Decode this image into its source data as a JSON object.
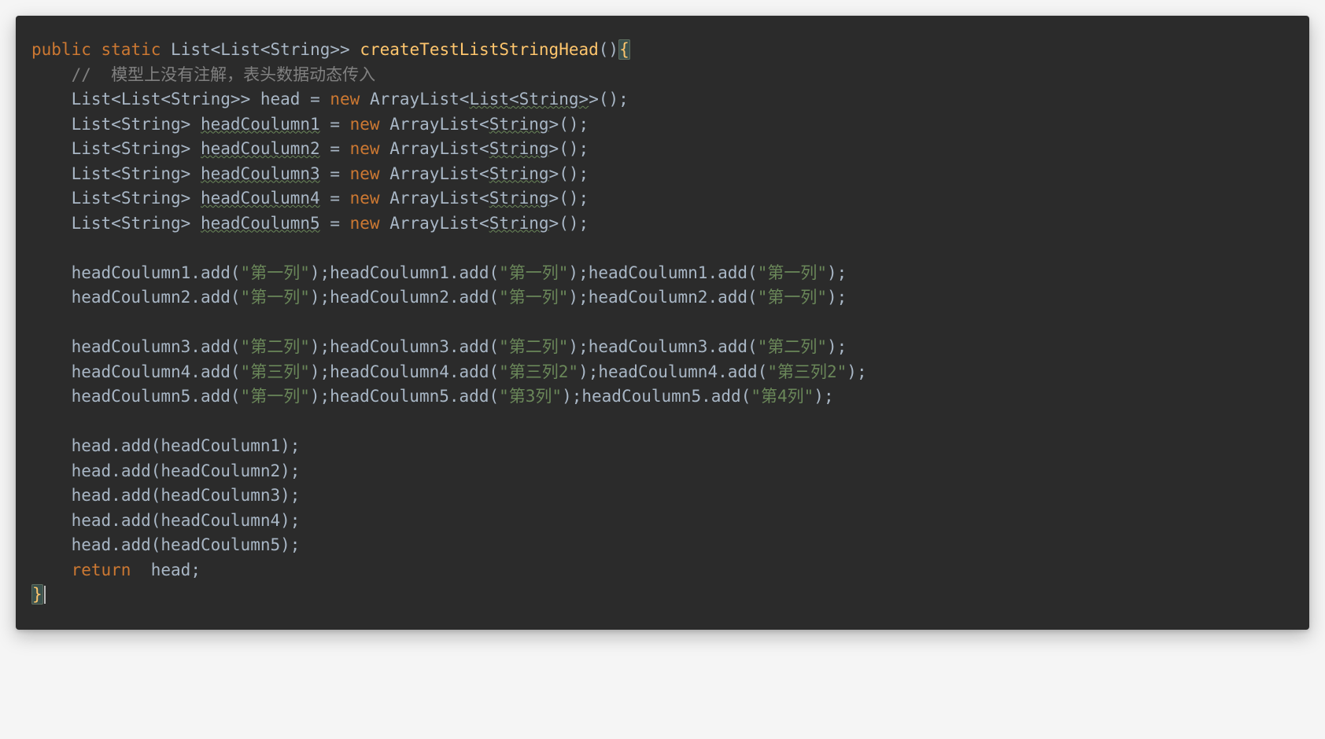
{
  "code": {
    "keywords": {
      "public": "public",
      "static": "static",
      "new": "new",
      "return": "return"
    },
    "types": {
      "List": "List",
      "String": "String",
      "ArrayList": "ArrayList"
    },
    "methodName": "createTestListStringHead",
    "comment": "//  模型上没有注解，表头数据动态传入",
    "vars": {
      "head": "head",
      "hc1": "headCoulumn1",
      "hc2": "headCoulumn2",
      "hc3": "headCoulumn3",
      "hc4": "headCoulumn4",
      "hc5": "headCoulumn5"
    },
    "strings": {
      "col1": "\"第一列\"",
      "col2": "\"第二列\"",
      "col3": "\"第三列\"",
      "col3_2": "\"第三列2\"",
      "col_n3": "\"第3列\"",
      "col_n4": "\"第4列\""
    },
    "ops": {
      "assign": " = ",
      "dot": ".",
      "add": "add",
      "lparen": "(",
      "rparen": ")",
      "semi": ";",
      "lt": "<",
      "gt": ">",
      "empty_generic": "()",
      "lbrace": "{",
      "rbrace": "}"
    }
  }
}
